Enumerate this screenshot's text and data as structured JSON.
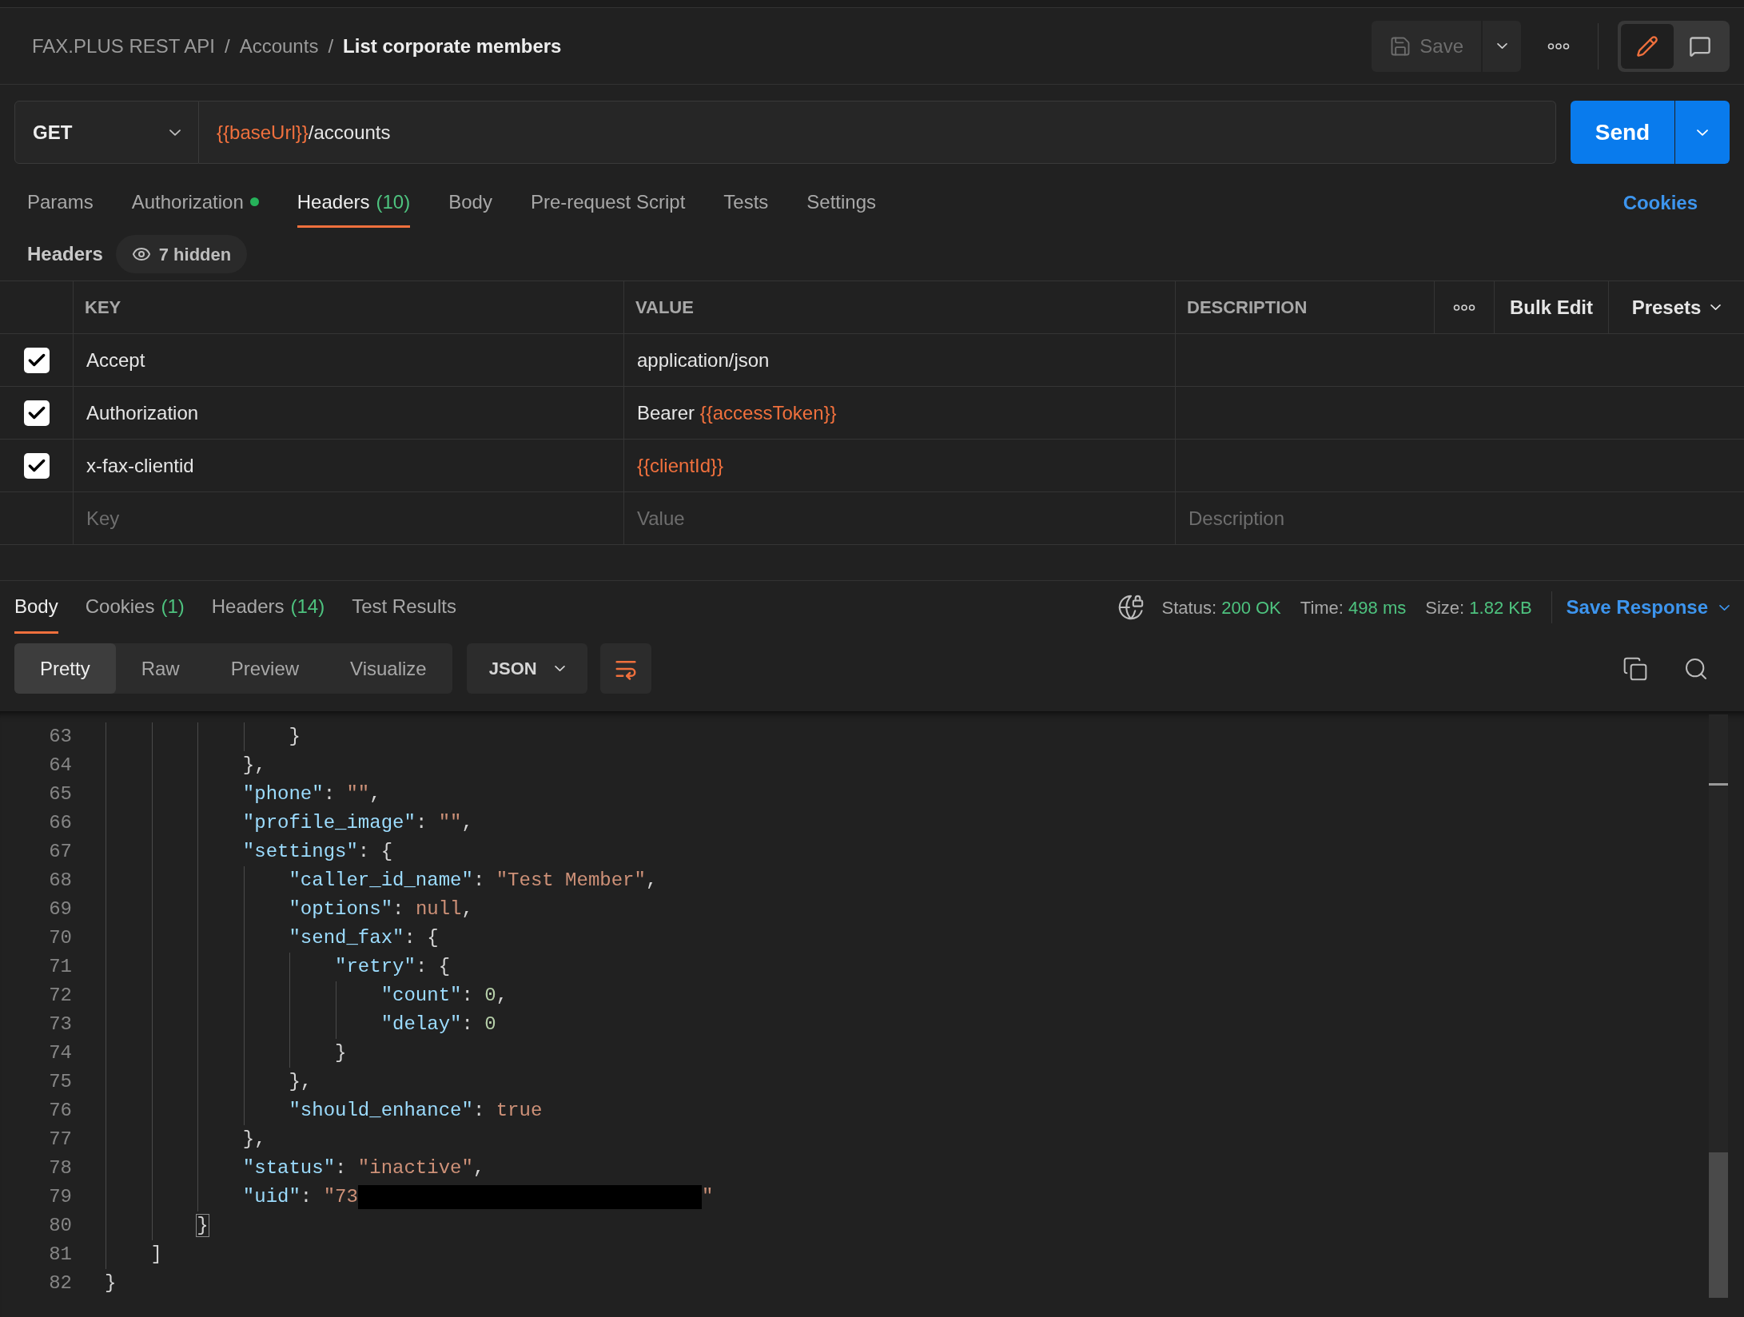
{
  "breadcrumb": [
    {
      "kind": "link",
      "label": "FAX.PLUS REST API"
    },
    {
      "kind": "separator",
      "label": "/"
    },
    {
      "kind": "link",
      "label": "Accounts"
    },
    {
      "kind": "separator",
      "label": "/"
    },
    {
      "kind": "current",
      "label": "List corporate members"
    }
  ],
  "header_actions": {
    "save": {
      "label": "Save",
      "disabled": true
    },
    "modes": [
      {
        "kind": "edit",
        "selected": true
      },
      {
        "kind": "comments",
        "selected": false
      }
    ]
  },
  "request": {
    "method": "GET",
    "url": [
      {
        "kind": "variable",
        "text": "{{baseUrl}}"
      },
      {
        "kind": "plain",
        "text": "/accounts"
      }
    ],
    "send": "Send"
  },
  "request_tabs": [
    {
      "label": "Params",
      "selected": false,
      "indicator": false
    },
    {
      "label": "Authorization",
      "selected": false,
      "indicator": true
    },
    {
      "label": "Headers",
      "count": "(10)",
      "selected": true,
      "indicator": false
    },
    {
      "label": "Body",
      "selected": false,
      "indicator": false
    },
    {
      "label": "Pre-request Script",
      "selected": false,
      "indicator": false
    },
    {
      "label": "Tests",
      "selected": false,
      "indicator": false
    },
    {
      "label": "Settings",
      "selected": false,
      "indicator": false
    }
  ],
  "cookies_link": "Cookies",
  "headers_section": {
    "title": "Headers",
    "hidden": "7 hidden"
  },
  "headers_table": {
    "columns": [
      "KEY",
      "VALUE",
      "DESCRIPTION"
    ],
    "bulk_edit": "Bulk Edit",
    "presets": "Presets",
    "rows": [
      {
        "checked": true,
        "key": "Accept",
        "value": [
          {
            "kind": "plain",
            "text": "application/json"
          }
        ]
      },
      {
        "checked": true,
        "key": "Authorization",
        "value": [
          {
            "kind": "plain",
            "text": "Bearer "
          },
          {
            "kind": "variable",
            "text": "{{accessToken}}"
          }
        ]
      },
      {
        "checked": true,
        "key": "x-fax-clientid",
        "value": [
          {
            "kind": "variable",
            "text": "{{clientId}}"
          }
        ]
      }
    ],
    "new_row": {
      "key_placeholder": "Key",
      "value_placeholder": "Value",
      "description_placeholder": "Description"
    }
  },
  "response": {
    "tabs": [
      {
        "label": "Body",
        "selected": true
      },
      {
        "label": "Cookies",
        "count": "(1)",
        "selected": false
      },
      {
        "label": "Headers",
        "count": "(14)",
        "selected": false
      },
      {
        "label": "Test Results",
        "selected": false
      }
    ],
    "stats": [
      {
        "label": "Status:",
        "value": "200 OK"
      },
      {
        "label": "Time:",
        "value": "498 ms"
      },
      {
        "label": "Size:",
        "value": "1.82 KB"
      }
    ],
    "save_response": "Save Response",
    "view_modes": [
      {
        "label": "Pretty",
        "selected": true
      },
      {
        "label": "Raw",
        "selected": false
      },
      {
        "label": "Preview",
        "selected": false
      },
      {
        "label": "Visualize",
        "selected": false
      }
    ],
    "format": "JSON",
    "code_lines": [
      {
        "number": "63",
        "tokens": [
          {
            "kind": "punct",
            "text": "                }"
          }
        ]
      },
      {
        "number": "64",
        "tokens": [
          {
            "kind": "punct",
            "text": "            },"
          }
        ]
      },
      {
        "number": "65",
        "tokens": [
          {
            "kind": "key",
            "text": "            \"phone\""
          },
          {
            "kind": "punct",
            "text": ": "
          },
          {
            "kind": "string",
            "text": "\"\""
          },
          {
            "kind": "punct",
            "text": ","
          }
        ]
      },
      {
        "number": "66",
        "tokens": [
          {
            "kind": "key",
            "text": "            \"profile_image\""
          },
          {
            "kind": "punct",
            "text": ": "
          },
          {
            "kind": "string",
            "text": "\"\""
          },
          {
            "kind": "punct",
            "text": ","
          }
        ]
      },
      {
        "number": "67",
        "tokens": [
          {
            "kind": "key",
            "text": "            \"settings\""
          },
          {
            "kind": "punct",
            "text": ": {"
          }
        ]
      },
      {
        "number": "68",
        "tokens": [
          {
            "kind": "key",
            "text": "                \"caller_id_name\""
          },
          {
            "kind": "punct",
            "text": ": "
          },
          {
            "kind": "string",
            "text": "\"Test Member\""
          },
          {
            "kind": "punct",
            "text": ","
          }
        ]
      },
      {
        "number": "69",
        "tokens": [
          {
            "kind": "key",
            "text": "                \"options\""
          },
          {
            "kind": "punct",
            "text": ": "
          },
          {
            "kind": "literal",
            "text": "null"
          },
          {
            "kind": "punct",
            "text": ","
          }
        ]
      },
      {
        "number": "70",
        "tokens": [
          {
            "kind": "key",
            "text": "                \"send_fax\""
          },
          {
            "kind": "punct",
            "text": ": {"
          }
        ]
      },
      {
        "number": "71",
        "tokens": [
          {
            "kind": "key",
            "text": "                    \"retry\""
          },
          {
            "kind": "punct",
            "text": ": {"
          }
        ]
      },
      {
        "number": "72",
        "tokens": [
          {
            "kind": "key",
            "text": "                        \"count\""
          },
          {
            "kind": "punct",
            "text": ": "
          },
          {
            "kind": "number",
            "text": "0"
          },
          {
            "kind": "punct",
            "text": ","
          }
        ]
      },
      {
        "number": "73",
        "tokens": [
          {
            "kind": "key",
            "text": "                        \"delay\""
          },
          {
            "kind": "punct",
            "text": ": "
          },
          {
            "kind": "number",
            "text": "0"
          }
        ]
      },
      {
        "number": "74",
        "tokens": [
          {
            "kind": "punct",
            "text": "                    }"
          }
        ]
      },
      {
        "number": "75",
        "tokens": [
          {
            "kind": "punct",
            "text": "                },"
          }
        ]
      },
      {
        "number": "76",
        "tokens": [
          {
            "kind": "key",
            "text": "                \"should_enhance\""
          },
          {
            "kind": "punct",
            "text": ": "
          },
          {
            "kind": "literal",
            "text": "true"
          }
        ]
      },
      {
        "number": "77",
        "tokens": [
          {
            "kind": "punct",
            "text": "            },"
          }
        ]
      },
      {
        "number": "78",
        "tokens": [
          {
            "kind": "key",
            "text": "            \"status\""
          },
          {
            "kind": "punct",
            "text": ": "
          },
          {
            "kind": "string",
            "text": "\"inactive\""
          },
          {
            "kind": "punct",
            "text": ","
          }
        ]
      },
      {
        "number": "79",
        "tokens": [
          {
            "kind": "key",
            "text": "            \"uid\""
          },
          {
            "kind": "punct",
            "text": ": "
          },
          {
            "kind": "string",
            "text": "\"73"
          },
          {
            "kind": "redacted"
          },
          {
            "kind": "string",
            "text": "\""
          }
        ]
      },
      {
        "number": "80",
        "tokens": [
          {
            "kind": "matched",
            "text": "        }"
          }
        ]
      },
      {
        "number": "81",
        "tokens": [
          {
            "kind": "punct",
            "text": "    ]"
          }
        ]
      },
      {
        "number": "82",
        "tokens": [
          {
            "kind": "punct",
            "text": "}"
          }
        ]
      }
    ]
  }
}
